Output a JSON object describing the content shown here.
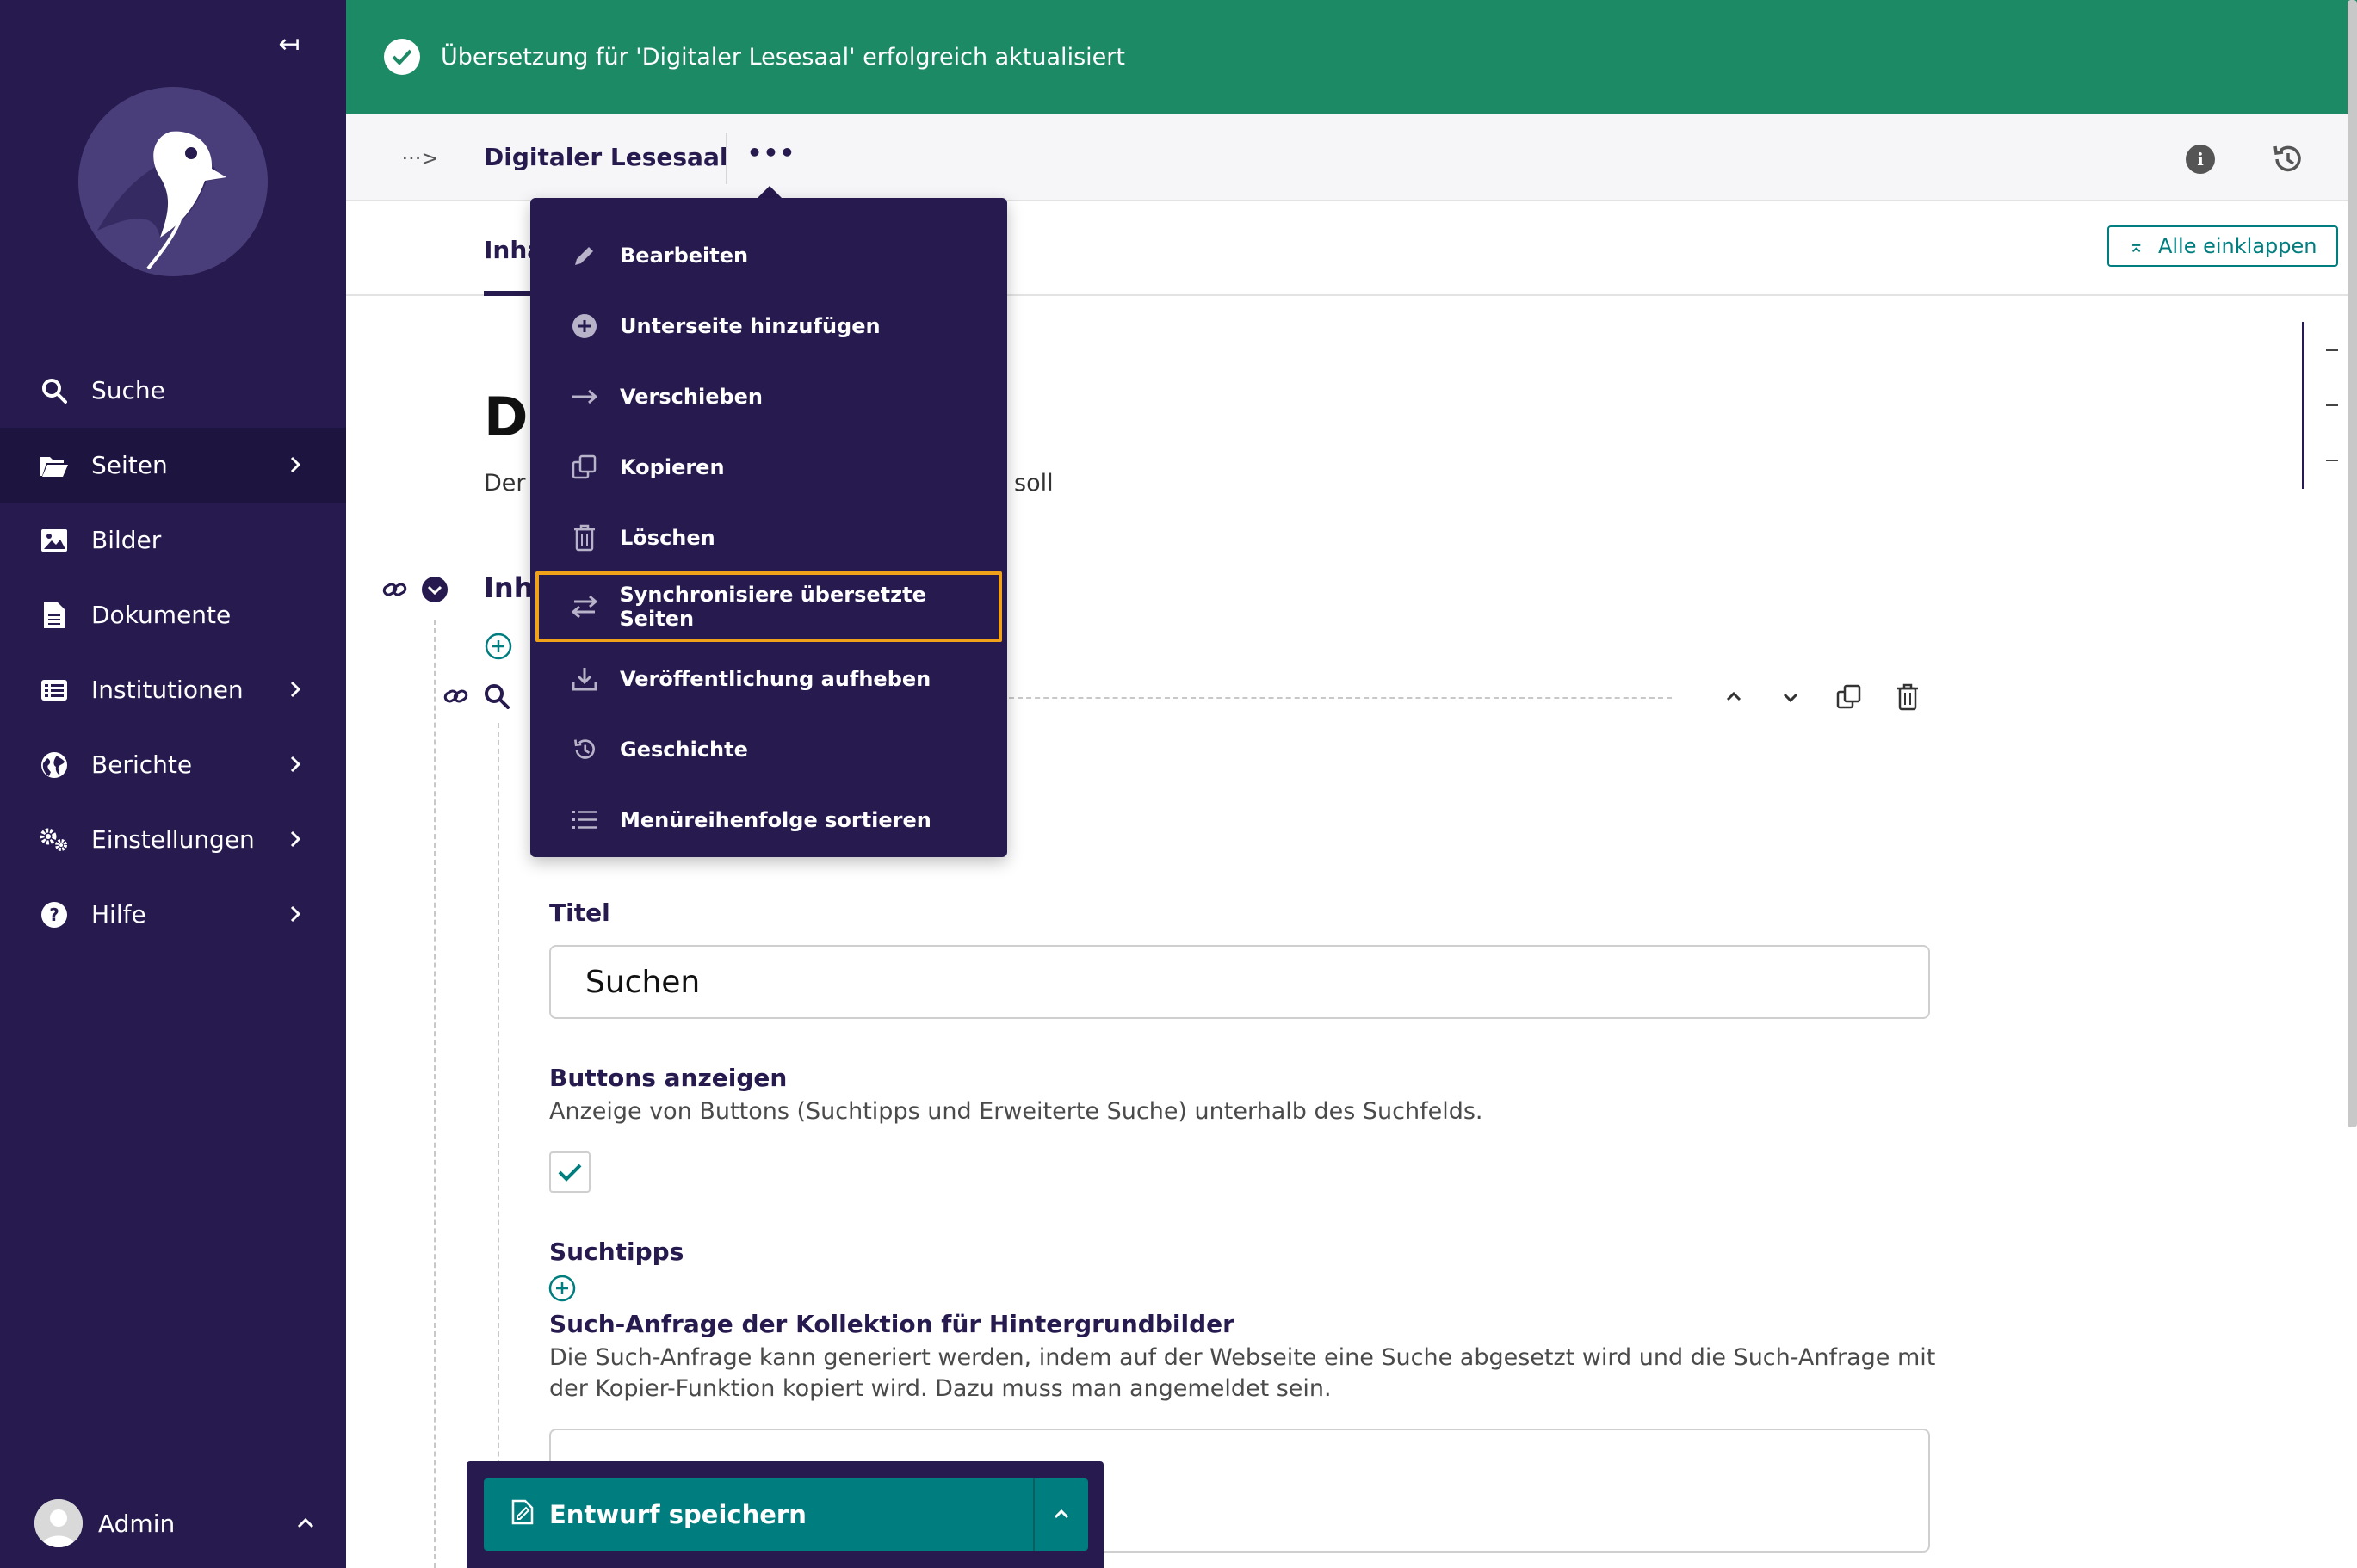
{
  "sidebar": {
    "collapse_glyph": "↤",
    "items": [
      {
        "label": "Suche",
        "icon": "search-icon",
        "has_chevron": false,
        "active": false
      },
      {
        "label": "Seiten",
        "icon": "folder-open-icon",
        "has_chevron": true,
        "active": true
      },
      {
        "label": "Bilder",
        "icon": "image-icon",
        "has_chevron": false,
        "active": false
      },
      {
        "label": "Dokumente",
        "icon": "document-icon",
        "has_chevron": false,
        "active": false
      },
      {
        "label": "Institutionen",
        "icon": "list-icon",
        "has_chevron": true,
        "active": false
      },
      {
        "label": "Berichte",
        "icon": "globe-icon",
        "has_chevron": true,
        "active": false
      },
      {
        "label": "Einstellungen",
        "icon": "cogs-icon",
        "has_chevron": true,
        "active": false
      },
      {
        "label": "Hilfe",
        "icon": "help-icon",
        "has_chevron": true,
        "active": false
      }
    ],
    "user": {
      "name": "Admin"
    }
  },
  "banner": {
    "message": "Übersetzung für 'Digitaler Lesesaal' erfolgreich aktualisiert",
    "color": "#1d8a66"
  },
  "header": {
    "breadcrumb_toggle": "···>",
    "title": "Digitaler Lesesaal",
    "more_glyph": "•••",
    "info_glyph": "i"
  },
  "tabs": {
    "active_tab_partial": "Inha"
  },
  "toolbar": {
    "collapse_all_label": "Alle einklappen",
    "collapse_all_glyph": "⌅"
  },
  "content": {
    "heading_partial": "Di",
    "description_left": "Der",
    "description_right": "soll",
    "section_heading_partial": "Inha"
  },
  "form": {
    "title_label": "Titel",
    "title_value": "Suchen",
    "buttons_label": "Buttons anzeigen",
    "buttons_help": "Anzeige von Buttons (Suchtipps und Erweiterte Suche) unterhalb des Suchfelds.",
    "buttons_checked": true,
    "tips_label": "Suchtipps",
    "query_label": "Such-Anfrage der Kollektion für Hintergrundbilder",
    "query_help": "Die Such-Anfrage kann generiert werden, indem auf der Webseite eine Suche abgesetzt wird und die Such-Anfrage mit der Kopier-Funktion kopiert wird. Dazu muss man angemeldet sein."
  },
  "savebar": {
    "save_label": "Entwurf speichern"
  },
  "menu": {
    "items": [
      {
        "label": "Bearbeiten",
        "icon": "pencil-icon"
      },
      {
        "label": "Unterseite hinzufügen",
        "icon": "plus-circle-icon"
      },
      {
        "label": "Verschieben",
        "icon": "arrow-right-icon"
      },
      {
        "label": "Kopieren",
        "icon": "copy-icon"
      },
      {
        "label": "Löschen",
        "icon": "trash-icon"
      },
      {
        "label": "Synchronisiere übersetzte Seiten",
        "icon": "sync-arrows-icon",
        "highlighted": true
      },
      {
        "label": "Veröffentlichung aufheben",
        "icon": "download-icon"
      },
      {
        "label": "Geschichte",
        "icon": "history-icon"
      },
      {
        "label": "Menüreihenfolge sortieren",
        "icon": "list-order-icon"
      }
    ],
    "highlight_color": "#f0a21b"
  },
  "colors": {
    "sidebar": "#261a4e",
    "accent": "#007d7e",
    "success": "#1d8a66"
  }
}
